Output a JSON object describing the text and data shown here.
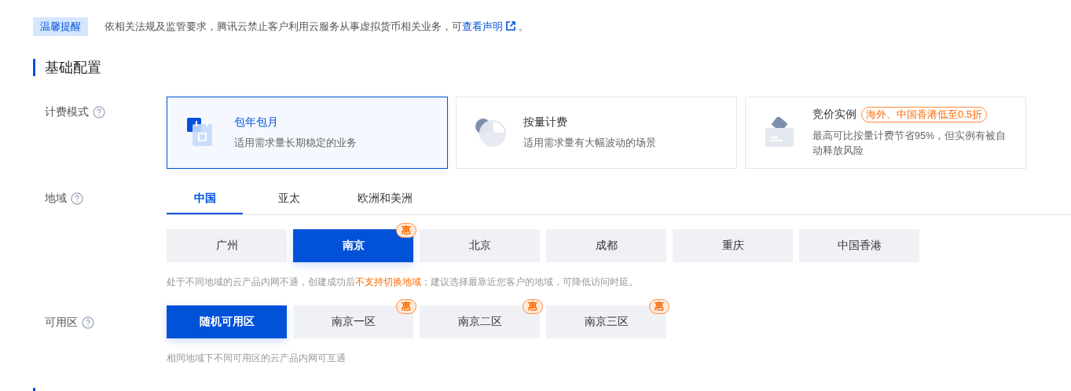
{
  "notice": {
    "tag": "温馨提醒",
    "text_before": "依相关法规及监管要求，腾讯云禁止客户利用云服务从事虚拟货币相关业务，可",
    "link": "查看声明",
    "text_after": "。"
  },
  "section": {
    "title": "基础配置"
  },
  "billing": {
    "label": "计费模式",
    "options": [
      {
        "kind": "calendar",
        "title": "包年包月",
        "desc": "适用需求量长期稳定的业务",
        "selected": true
      },
      {
        "kind": "pie",
        "title": "按量计费",
        "desc": "适用需求量有大幅波动的场景",
        "selected": false
      },
      {
        "kind": "tag",
        "title": "竞价实例",
        "tag": "海外、中国香港低至0.5折",
        "desc": "最高可比按量计费节省95%，但实例有被自动释放风险",
        "selected": false
      }
    ]
  },
  "region": {
    "label": "地域",
    "tabs": [
      {
        "label": "中国",
        "selected": true
      },
      {
        "label": "亚太",
        "selected": false
      },
      {
        "label": "欧洲和美洲",
        "selected": false
      }
    ],
    "cities": [
      {
        "name": "广州",
        "selected": false
      },
      {
        "name": "南京",
        "selected": true,
        "promo": "惠"
      },
      {
        "name": "北京",
        "selected": false
      },
      {
        "name": "成都",
        "selected": false
      },
      {
        "name": "重庆",
        "selected": false
      },
      {
        "name": "中国香港",
        "selected": false
      }
    ],
    "hint_before": "处于不同地域的云产品内网不通，创建成功后",
    "hint_emphasis": "不支持切换地域",
    "hint_after": "；建议选择最靠近您客户的地域，可降低访问时延。"
  },
  "zone": {
    "label": "可用区",
    "options": [
      {
        "name": "随机可用区",
        "selected": true
      },
      {
        "name": "南京一区",
        "selected": false,
        "promo": "惠"
      },
      {
        "name": "南京二区",
        "selected": false,
        "promo": "惠"
      },
      {
        "name": "南京三区",
        "selected": false,
        "promo": "惠"
      }
    ],
    "hint": "相同地域下不同可用区的云产品内网可互通"
  }
}
